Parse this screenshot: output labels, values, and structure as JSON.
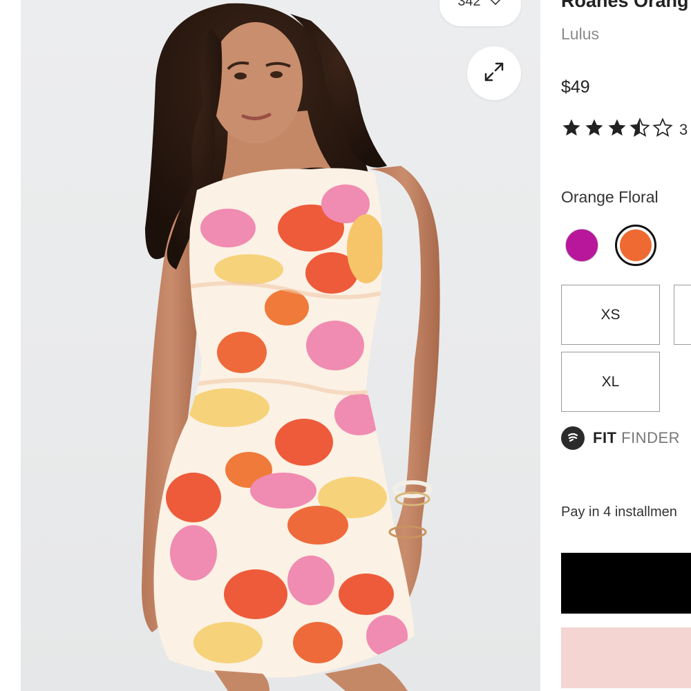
{
  "favorites": {
    "count": "342",
    "icon": "heart-icon"
  },
  "expand": {
    "icon": "expand-arrows-icon"
  },
  "product": {
    "title": "Roanes Orang",
    "brand": "Lulus",
    "price": "$49",
    "rating": {
      "value": 3.5,
      "max": 5,
      "count_text": "3"
    }
  },
  "color": {
    "selected_name": "Orange Floral",
    "swatches": [
      {
        "name": "magenta",
        "hex": "#b8169b",
        "selected": false
      },
      {
        "name": "orange",
        "hex": "#ee6a32",
        "selected": true
      }
    ]
  },
  "sizes": [
    "XS",
    "",
    "XL"
  ],
  "fit_finder": {
    "bold": "FIT",
    "light": "FINDER"
  },
  "installments_text": "Pay in 4 installmen",
  "colors": {
    "accent_orange": "#ee6a32",
    "buy_button": "#000000",
    "secondary_button": "#f4d5d2"
  }
}
